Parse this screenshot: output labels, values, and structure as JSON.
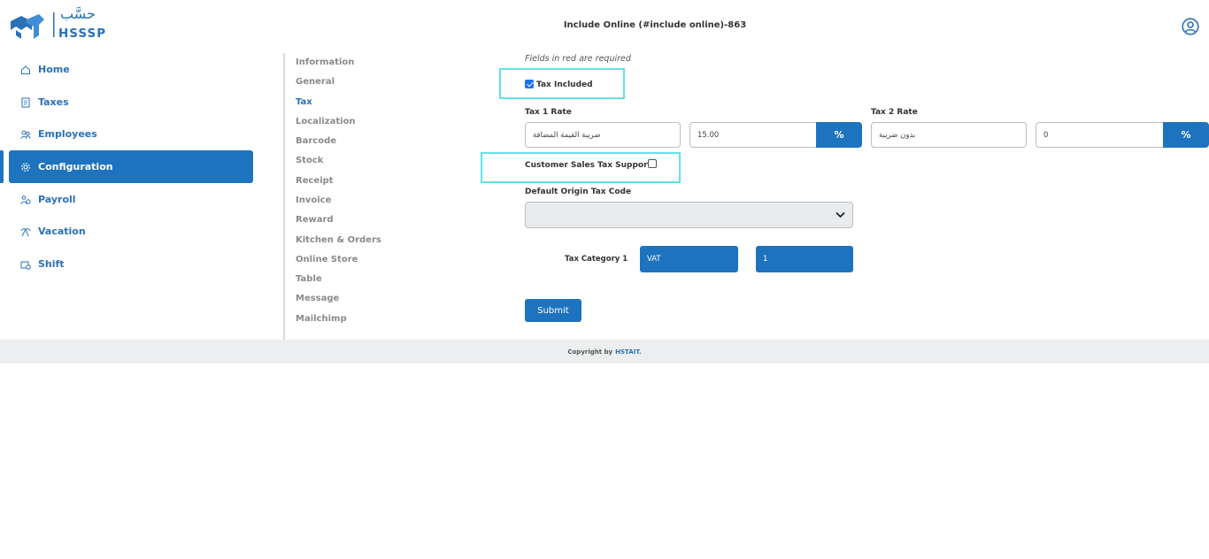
{
  "header": {
    "logo_text": "HSSSP",
    "logo_arabic": "حسَّب",
    "page_title": "Include Online (#include online)-863",
    "user_icon": "user-circle-icon"
  },
  "sidebar": {
    "items": [
      {
        "label": "Home",
        "icon": "home-icon"
      },
      {
        "label": "Taxes",
        "icon": "receipt-icon"
      },
      {
        "label": "Employees",
        "icon": "people-icon"
      },
      {
        "label": "Configuration",
        "icon": "gear-icon",
        "active": true
      },
      {
        "label": "Payroll",
        "icon": "payroll-icon"
      },
      {
        "label": "Vacation",
        "icon": "vacation-icon"
      },
      {
        "label": "Shift",
        "icon": "shift-icon"
      }
    ]
  },
  "submenu": {
    "items": [
      "Information",
      "General",
      "Tax",
      "Localization",
      "Barcode",
      "Stock",
      "Receipt",
      "Invoice",
      "Reward",
      "Kitchen & Orders",
      "Online Store",
      "Table",
      "Message",
      "Mailchimp"
    ],
    "active": "Tax"
  },
  "form": {
    "required_note": "Fields in red are required",
    "tax_included_label": "Tax Included",
    "tax_included_checked": true,
    "tax1_label": "Tax 1 Rate",
    "tax1_name": "ضريبة القيمة المضافة",
    "tax1_rate": "15.00",
    "tax2_label": "Tax 2 Rate",
    "tax2_name": "بدون ضريبة",
    "tax2_rate": "0",
    "percent_symbol": "%",
    "customer_sales_tax_label": "Customer Sales Tax Support",
    "customer_sales_tax_checked": false,
    "default_origin_label": "Default Origin Tax Code",
    "default_origin_value": "",
    "tax_category_label": "Tax Category 1",
    "tax_category_name": "VAT",
    "tax_category_value": "1",
    "submit_label": "Submit"
  },
  "footer": {
    "copyright": "Copyright by",
    "brand": "HSTAIT."
  },
  "colors": {
    "primary": "#1e73be",
    "highlight": "#5ee3e9",
    "footer_bg": "#eceeef"
  }
}
